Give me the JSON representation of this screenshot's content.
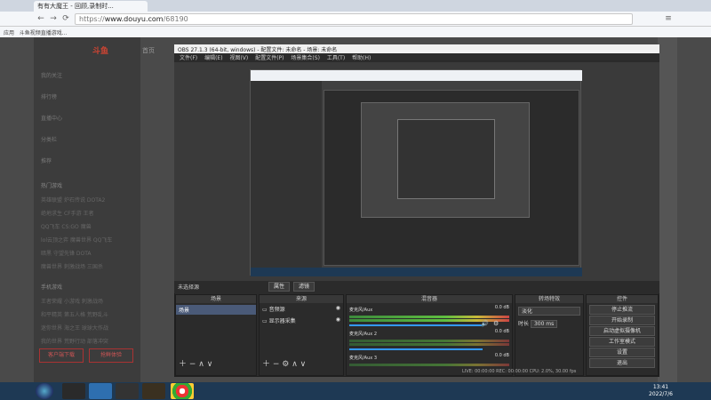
{
  "browser": {
    "tab_title": "有有大魔王 - 回顾,录制时...",
    "url_prefix": "https://",
    "url_host": "www.douyu.com",
    "url_path": "/68190",
    "bookmarks": [
      "应用",
      "斗鱼视频直播游戏..."
    ]
  },
  "douyu": {
    "logo": "斗鱼",
    "home": "首页",
    "nav": [
      "我的关注",
      "排行榜",
      "直播中心",
      "分类栏",
      "推荐"
    ],
    "section_title": "热门游戏",
    "games": [
      [
        "英雄联盟",
        "炉石传说",
        "DOTA2"
      ],
      [
        "绝地求生",
        "CF手游",
        "王者"
      ],
      [
        "QQ飞车",
        "CS:GO",
        "魔兽"
      ],
      [
        "lol云顶之弈",
        "魔兽世界",
        "QQ飞车"
      ],
      [
        "暗黑",
        "守望先锋",
        "DOTA"
      ],
      [
        "魔兽世界",
        "刺激战场",
        "三国杀"
      ]
    ],
    "section2_title": "手机游戏",
    "mobile": [
      [
        "王者荣耀",
        "小游戏",
        "刺激战场"
      ],
      [
        "和平精英",
        "第五人格",
        "荒野乱斗"
      ],
      [
        "迷你世界",
        "海之王",
        "球球大作战"
      ],
      [
        "我的世界",
        "荒野行动",
        "部落冲突"
      ]
    ],
    "btn_left": "客户端下载",
    "btn_right": "抢鲜体验"
  },
  "obs": {
    "title": "OBS 27.1.3 (64-bit, windows) - 配置文件: 未命名 - 场景: 未命名",
    "menu": [
      "文件(F)",
      "编辑(E)",
      "视图(V)",
      "配置文件(P)",
      "场景集合(S)",
      "工具(T)",
      "帮助(H)"
    ],
    "no_source": "未选择源",
    "props_btn": "属性",
    "filters_btn": "滤镜",
    "scenes_header": "场景",
    "scene_item": "场景",
    "sources_header": "来源",
    "sources": [
      "音频源",
      "显示器采集"
    ],
    "mixer_header": "混音器",
    "mixer": [
      {
        "name": "麦克风/Aux",
        "db": "0.0 dB"
      },
      {
        "name": "麦克风/Aux 2",
        "db": "0.0 dB"
      },
      {
        "name": "麦克风/Aux 3",
        "db": "0.0 dB"
      }
    ],
    "transitions_header": "转场特效",
    "transition_type": "淡化",
    "duration_label": "时长",
    "duration_value": "300 ms",
    "controls_header": "控件",
    "controls": [
      "停止推流",
      "开始录制",
      "启动虚拟摄像机",
      "工作室模式",
      "设置",
      "退出"
    ],
    "status": "LIVE: 00:00:00   REC: 00:00:00   CPU: 2.0%, 30.00 fps"
  },
  "taskbar": {
    "time": "13:41",
    "date": "2022/7/6"
  }
}
